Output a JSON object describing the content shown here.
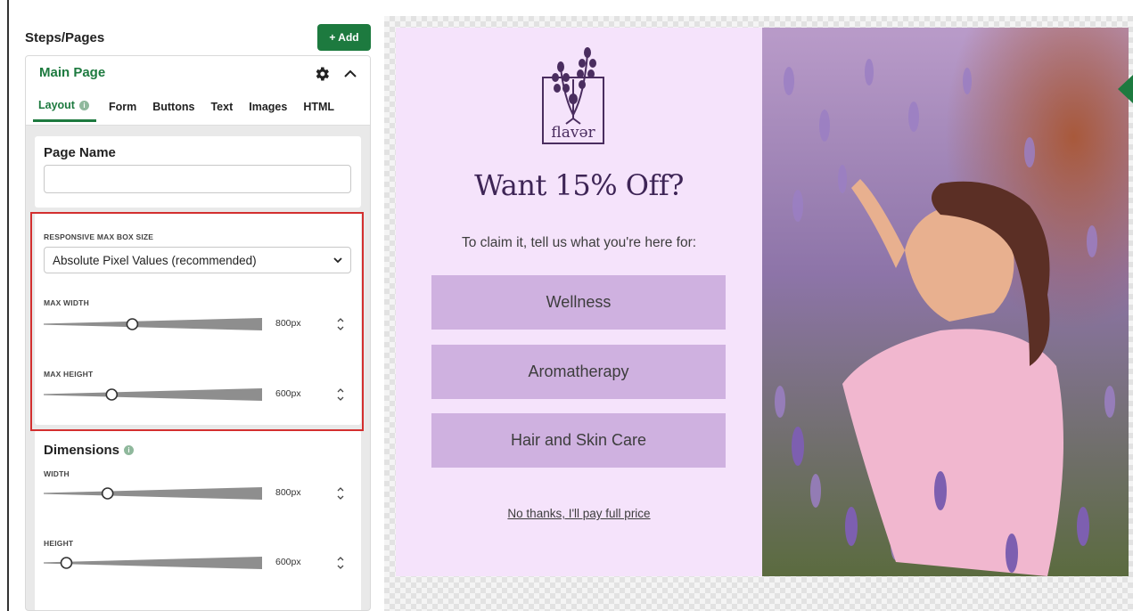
{
  "panel": {
    "title": "Steps/Pages",
    "add_label": "+ Add"
  },
  "card": {
    "title": "Main Page",
    "tabs": [
      {
        "label": "Layout",
        "active": true
      },
      {
        "label": "Form"
      },
      {
        "label": "Buttons"
      },
      {
        "label": "Text"
      },
      {
        "label": "Images"
      },
      {
        "label": "HTML"
      }
    ],
    "page_name": {
      "label": "Page Name",
      "value": ""
    },
    "responsive": {
      "label": "RESPONSIVE MAX BOX SIZE",
      "selected": "Absolute Pixel Values (recommended)",
      "max_width": {
        "label": "MAX WIDTH",
        "value": "800px",
        "level": 0.4
      },
      "max_height": {
        "label": "MAX HEIGHT",
        "value": "600px",
        "level": 0.3
      }
    },
    "dimensions": {
      "label": "Dimensions",
      "width": {
        "label": "WIDTH",
        "value": "800px",
        "level": 0.28
      },
      "height": {
        "label": "HEIGHT",
        "value": "600px",
        "level": 0.08
      }
    }
  },
  "preview": {
    "logo_text": "flavər",
    "headline": "Want 15% Off?",
    "subhead": "To claim it, tell us what you're here for:",
    "choices": [
      "Wellness",
      "Aromatherapy",
      "Hair and Skin Care"
    ],
    "decline": "No thanks, I'll pay full price"
  },
  "colors": {
    "accent": "#1d7a3f",
    "popup_bg": "#f5e3fb",
    "choice_bg": "#cfb1e0",
    "headline": "#3e2556",
    "highlight": "#d32f2f"
  }
}
